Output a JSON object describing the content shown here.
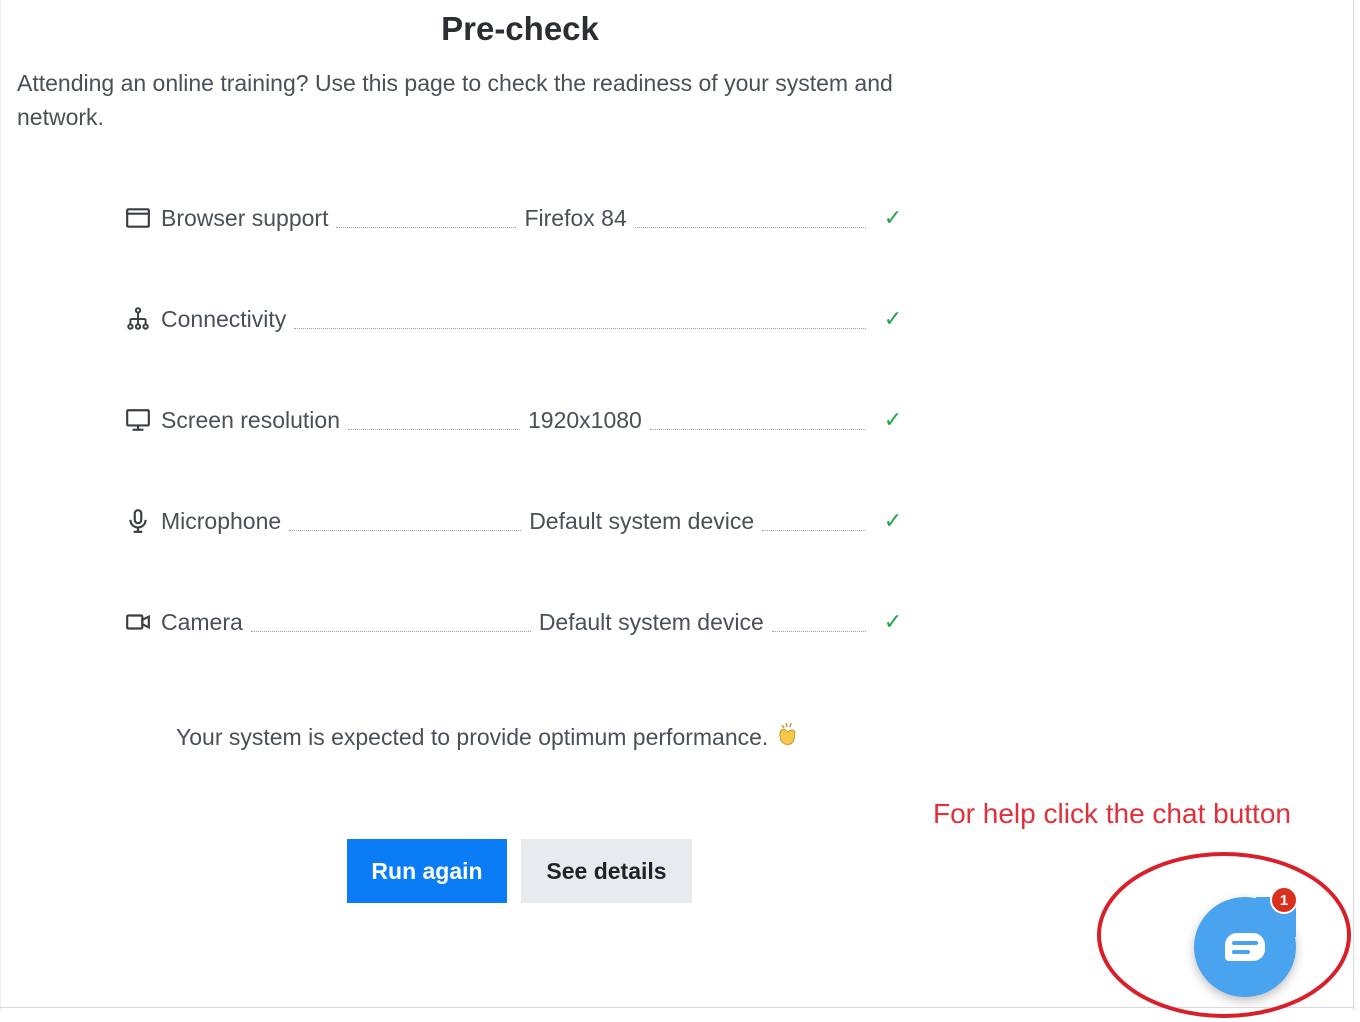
{
  "page": {
    "title": "Pre-check",
    "intro": "Attending an online training? Use this page to check the readiness of your system and network."
  },
  "checks": [
    {
      "icon": "browser-window-icon",
      "label": "Browser support",
      "value": "Firefox 84",
      "status": "✓"
    },
    {
      "icon": "network-icon",
      "label": "Connectivity",
      "value": "",
      "status": "✓"
    },
    {
      "icon": "monitor-icon",
      "label": "Screen resolution",
      "value": "1920x1080",
      "status": "✓"
    },
    {
      "icon": "microphone-icon",
      "label": "Microphone",
      "value": "Default system device",
      "status": "✓"
    },
    {
      "icon": "camera-icon",
      "label": "Camera",
      "value": "Default system device",
      "status": "✓"
    }
  ],
  "summary": {
    "text": "Your system is expected to provide optimum performance.",
    "icon": "clapping-hands-icon"
  },
  "buttons": {
    "run_again": "Run again",
    "see_details": "See details"
  },
  "help": {
    "note": "For help click the chat button",
    "chat_badge": "1",
    "chat_icon": "chat-bubble-icon"
  },
  "colors": {
    "primary": "#0a7cf5",
    "success": "#22a447",
    "annotation": "#e0303c",
    "chat": "#4aa3ef",
    "badge": "#d8301c"
  }
}
